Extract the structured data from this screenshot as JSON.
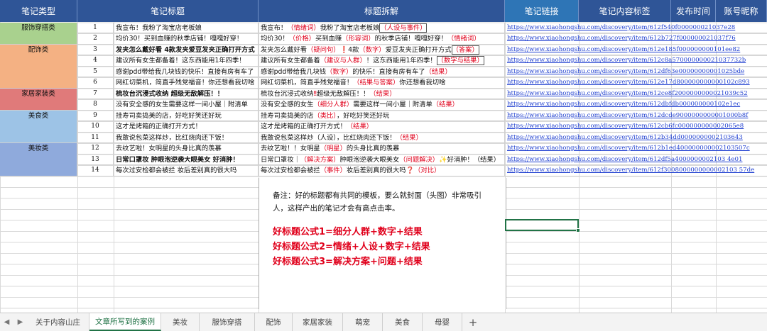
{
  "colors": {
    "header_dark": "#2f5597",
    "header_light": "#2e75b6",
    "cat_fashion": "#a9d18e",
    "cat_accessory": "#f4b183",
    "cat_home": "#e07a7a",
    "cat_food": "#9dc3e6",
    "cat_beauty": "#8faadc",
    "accent_red": "#e0001b",
    "link_blue": "#1f3fd0",
    "active_tab": "#217346"
  },
  "headers": [
    "笔记类型",
    "笔记标题",
    "标题拆解",
    "笔记链接",
    "笔记内容标签",
    "发布时间",
    "账号昵称"
  ],
  "categories": [
    {
      "label": "服饰穿搭类"
    },
    {
      "label": "配饰类"
    },
    {
      "label": "家居家装类"
    },
    {
      "label": "美食类"
    },
    {
      "label": "美妆类"
    }
  ],
  "rows": [
    {
      "n": "1",
      "title": "我宣布！我粉了淘宝店老板娘",
      "link": "https://www.xiaohongshu.com/discovery/item/612f540f000000021037e28"
    },
    {
      "n": "2",
      "title": "均价30！买到血赚的秋季店铺！嘎嘎好穿！",
      "link": "https://www.xiaohongshu.com/discovery/item/612b727f000000021037f76"
    },
    {
      "n": "3",
      "title": "发夹怎么戴好看 4款发夹爱豆发夹正确打开方式",
      "link": "https://www.xiaohongshu.com/discovery/item/612e185f000000000101ee82"
    },
    {
      "n": "4",
      "title": "建议所有女生都备着！这东西能用1年四季！",
      "link": "https://www.xiaohongshu.com/discovery/item/612c8a570000000021037732b"
    },
    {
      "n": "5",
      "title": "感谢pdd带给我几块钱的快乐！直接有房有车了",
      "link": "https://www.xiaohongshu.com/discovery/item/612df63e00000000001025bde"
    },
    {
      "n": "6",
      "title": "网红切菜机，简直手残党福音！你还想看我切啥",
      "link": "https://www.xiaohongshu.com/discovery/item/612e17d800000000000102c893"
    },
    {
      "n": "7",
      "title": "梳妆台沉浸式收纳 超级无敌解压！！",
      "link": "https://www.xiaohongshu.com/discovery/item/612ce8f2000000000021039c52"
    },
    {
      "n": "8",
      "title": "没有安全感的女生需要这样一间小屋｜附清单",
      "link": "https://www.xiaohongshu.com/discovery/item/612dbfdb000000000102e1ec"
    },
    {
      "n": "9",
      "title": "挂寿司卖捣美的店，好吃好笑还好玩",
      "link": "https://www.xiaohongshu.com/discovery/item/612dcde9000000000001000b8f"
    },
    {
      "n": "10",
      "title": "这才是烤箱的正确打开方式！",
      "link": "https://www.xiaohongshu.com/discovery/item/612cb6fc000000000002065e8"
    },
    {
      "n": "11",
      "title": "我敢说包菜这样炒，比红烧肉还下饭！",
      "link": "https://www.xiaohongshu.com/discovery/item/612b34dd0000000002103643"
    },
    {
      "n": "12",
      "title": "去纹艺啦！女明星的头身比真的羡慕",
      "link": "https://www.xiaohongshu.com/discovery/item/612b1ed400000000002103507c"
    },
    {
      "n": "13",
      "title": "日常口罩妆 肿眼泡逆袭大眼美女 好消肿！",
      "link": "https://www.xiaohongshu.com/discovery/item/612df5a4000000002103 4e01"
    },
    {
      "n": "14",
      "title": "每次过安检都会被拦 妆后差别真的很大吗",
      "link": "https://www.xiaohongshu.com/discovery/item/612f3008000000000002103 57de"
    }
  ],
  "breakdowns": [
    [
      {
        "t": "我宣布！"
      },
      {
        "t": "（情绪词）",
        "red": true
      },
      {
        "t": "我粉了淘宝店老板娘"
      },
      {
        "t": "（人设与事件）",
        "red": true,
        "box": true
      }
    ],
    [
      {
        "t": "均价30！"
      },
      {
        "t": "（价格）",
        "red": true
      },
      {
        "t": "买到血赚"
      },
      {
        "t": "（形容词）",
        "red": true
      },
      {
        "t": "的秋季店铺！嘎嘎好穿！"
      },
      {
        "t": "（情绪词）",
        "red": true
      }
    ],
    [
      {
        "t": "发夹怎么戴好看"
      },
      {
        "t": "（疑问句）",
        "red": true
      },
      {
        "t": "❗",
        "red": true
      },
      {
        "t": "4款"
      },
      {
        "t": "（数字）",
        "red": true
      },
      {
        "t": "爱豆发夹正确打开方式"
      },
      {
        "t": "（答案）",
        "red": true,
        "box": true
      }
    ],
    [
      {
        "t": "建议所有女生都备着"
      },
      {
        "t": "（建议与人群）",
        "red": true
      },
      {
        "t": "！这东西能用1年四季！"
      },
      {
        "t": "（数字与结果）",
        "red": true,
        "box": true
      }
    ],
    [
      {
        "t": "感谢pdd带给我几块钱"
      },
      {
        "t": "（数字）",
        "red": true
      },
      {
        "t": "的快乐！直接有房有车了"
      },
      {
        "t": "（结果）",
        "red": true
      }
    ],
    [
      {
        "t": "网红切菜机，简直手残党福音！"
      },
      {
        "t": "（结果与答案）",
        "red": true
      },
      {
        "t": "你还想看我切啥"
      }
    ],
    [
      {
        "t": "梳妆台沉浸式收纳"
      },
      {
        "t": "‼",
        "red": true
      },
      {
        "t": "超级无敌解压！！"
      },
      {
        "t": "（结果）",
        "red": true
      }
    ],
    [
      {
        "t": "没有安全感的女生"
      },
      {
        "t": "（细分人群）",
        "red": true
      },
      {
        "t": "需要这样一间小屋｜附清单"
      },
      {
        "t": "（结果）",
        "red": true
      }
    ],
    [
      {
        "t": "挂寿司卖捣美的店"
      },
      {
        "t": "（类比）",
        "red": true
      },
      {
        "t": "，好吃好笑还好玩"
      }
    ],
    [
      {
        "t": "这才是烤箱的正确打开方式！"
      },
      {
        "t": "（结果）",
        "red": true
      }
    ],
    [
      {
        "t": "我敢说包菜这样炒（人设），比红烧肉还下饭！"
      },
      {
        "t": "（结果）",
        "red": true
      }
    ],
    [
      {
        "t": "去纹艺啦！！女明星"
      },
      {
        "t": "（明星）",
        "red": true
      },
      {
        "t": "的头身比真的羡慕"
      }
    ],
    [
      {
        "t": "日常口罩妆｜"
      },
      {
        "t": "（解决方案）",
        "red": true
      },
      {
        "t": "肿眼泡逆袭大眼美女"
      },
      {
        "t": "（问题解决）",
        "red": true
      },
      {
        "t": "✨好消肿！（结果）"
      }
    ],
    [
      {
        "t": "每次过安检都会被拦"
      },
      {
        "t": "（事件）",
        "red": true
      },
      {
        "t": "妆后差别真的很大吗"
      },
      {
        "t": "❓",
        "red": true
      },
      {
        "t": "（对比）",
        "red": true
      }
    ]
  ],
  "note": {
    "desc": "备注：好的标题都有共同的模板，要么就封面（头图）非常吸引人，这样产出的笔记才会有高点击率。",
    "formula1": "好标题公式1=细分人群+数字+结果",
    "formula2": "好标题公式2=情绪+人设+数字+结果",
    "formula3": "好标题公式3=解决方案+问题+结果"
  },
  "tabs": [
    "关于内容山庄",
    "文章所写到的案例",
    "美妆",
    "服饰穿搭",
    "配饰",
    "家居家装",
    "萌宠",
    "美食",
    "母婴"
  ],
  "active_tab": "文章所写到的案例",
  "nav": {
    "prev": "◀",
    "next": "▶",
    "add": "+"
  }
}
